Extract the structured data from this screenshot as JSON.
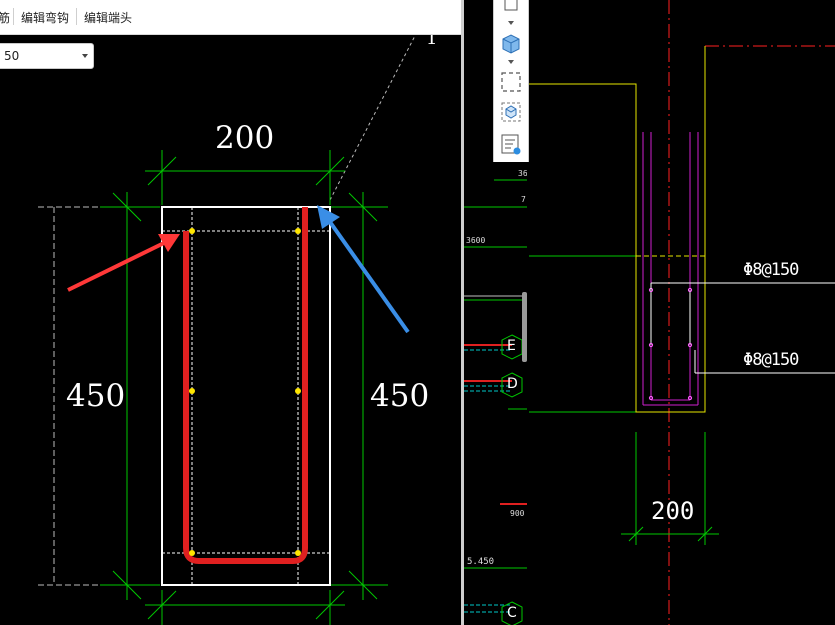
{
  "menu": {
    "cut_label": "筋",
    "edit_hook_label": "编辑弯钩",
    "edit_end_label": "编辑端头"
  },
  "spacing_select": {
    "value": "50"
  },
  "section": {
    "width_label": "200",
    "height_left_label": "450",
    "height_right_label": "450",
    "corner_label": "1"
  },
  "middle_pane": {
    "labels": [
      "36",
      "7",
      "3600",
      "900",
      "5.450"
    ],
    "axis_labels": [
      "E",
      "D",
      "C"
    ]
  },
  "right_pane": {
    "rebar_top": "Φ8@150",
    "rebar_bottom": "Φ8@150",
    "width_label": "200"
  },
  "toolbar": {
    "icons": [
      "page-icon",
      "cube-icon",
      "dashed-select-icon",
      "cube-view-icon",
      "text-view-icon"
    ]
  },
  "colors": {
    "cad_background": "#000000",
    "dimension_green": "#00c800",
    "stirrup_red": "#e02020",
    "axis_red": "#ff2020",
    "column_yellow": "#e6e600",
    "rebar_magenta": "#d020d0",
    "arrow_red": "#ff3838",
    "arrow_blue": "#3a8ee6"
  }
}
